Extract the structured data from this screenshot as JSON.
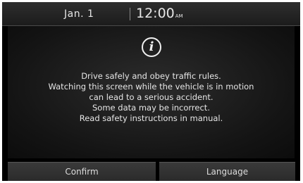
{
  "status_bar": {
    "date": "Jan.  1",
    "time": "12:00",
    "ampm": "AM"
  },
  "dialog": {
    "icon": "info-icon",
    "message_lines": [
      "Drive safely and obey traffic rules.",
      "Watching this screen while the vehicle is in motion",
      "can lead to a serious accident.",
      "Some data may be incorrect.",
      "Read safety instructions in manual."
    ]
  },
  "buttons": {
    "confirm_label": "Confirm",
    "language_label": "Language"
  }
}
